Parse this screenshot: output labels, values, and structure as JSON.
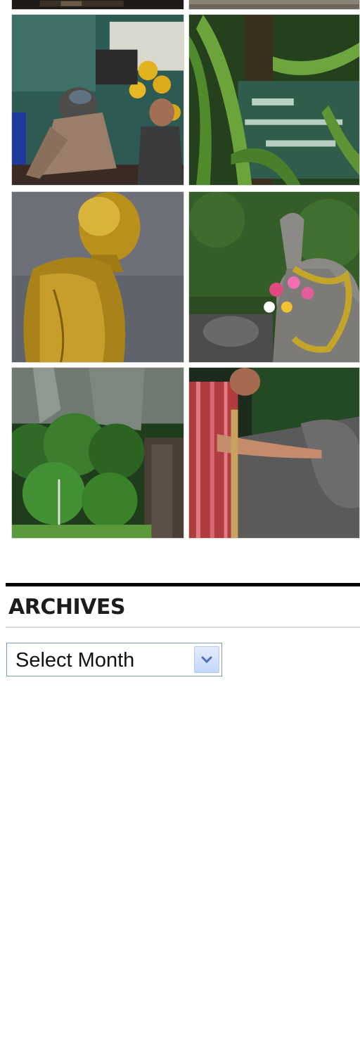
{
  "gallery": {
    "thumbnails": [
      {
        "name": "photo-top-left-cropped",
        "alt": "photo-1"
      },
      {
        "name": "photo-top-right-cropped",
        "alt": "photo-2"
      },
      {
        "name": "photo-market-workers",
        "alt": "photo-3"
      },
      {
        "name": "photo-jungle-sign",
        "alt": "photo-4"
      },
      {
        "name": "photo-golden-buddha",
        "alt": "photo-5"
      },
      {
        "name": "photo-decorated-elephant",
        "alt": "photo-6"
      },
      {
        "name": "photo-jungle-cliff",
        "alt": "photo-7"
      },
      {
        "name": "photo-man-touching-elephant",
        "alt": "photo-8"
      }
    ]
  },
  "archives": {
    "title": "ARCHIVES",
    "select": {
      "selected": "Select Month",
      "icon": "chevron-down-icon"
    }
  },
  "colors": {
    "rule": "#000000",
    "select_border": "#7f9db9",
    "select_button": "#c4d6fb"
  }
}
